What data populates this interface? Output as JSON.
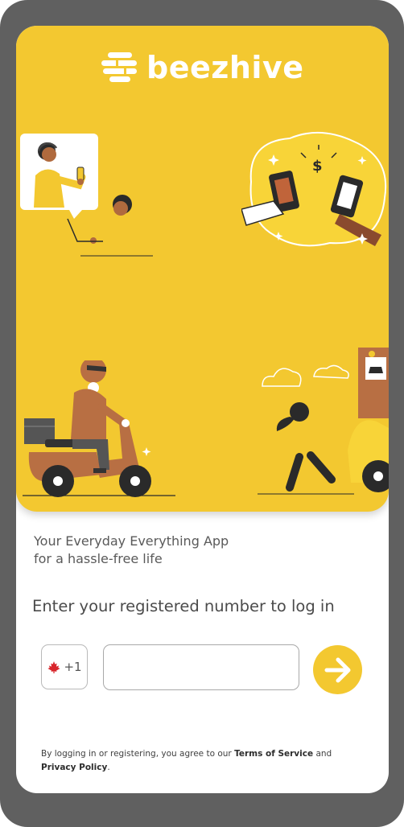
{
  "brand": {
    "name": "beezhive"
  },
  "tagline": {
    "line1": "Your Everyday Everything App",
    "line2": "for a hassle-free life"
  },
  "login": {
    "prompt": "Enter your registered number to log in",
    "country_code": "+1",
    "country_flag_icon": "canada-flag-icon",
    "phone_value": "",
    "phone_placeholder": "",
    "submit_icon": "arrow-right-icon"
  },
  "legal": {
    "prefix": "By logging in or registering, you agree to our ",
    "terms": "Terms of Service",
    "and": " and",
    "privacy": "Privacy Policy",
    "suffix": "."
  },
  "colors": {
    "accent": "#f3c830",
    "frame": "#606060",
    "text": "#4b4b4b"
  }
}
